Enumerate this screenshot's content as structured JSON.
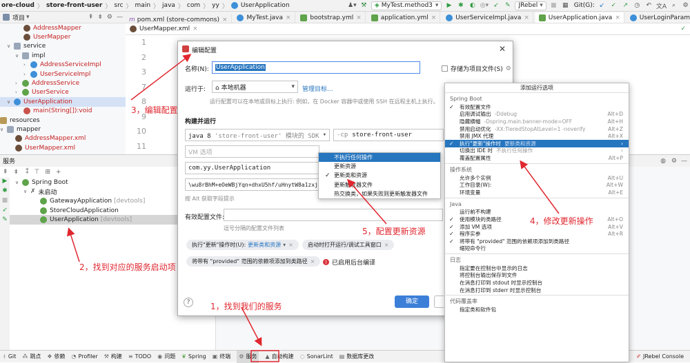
{
  "toolbar": {
    "crumbs": [
      "ore-cloud",
      "store-front-user",
      "src",
      "main",
      "java",
      "com",
      "yy",
      "UserApplication"
    ],
    "run_config": "MyTest.method3",
    "jrebel": "JRebel",
    "git": "Git(G):"
  },
  "project_panel": {
    "title": "项目",
    "items": [
      {
        "label": "AddressMapper",
        "red": true
      },
      {
        "label": "UserMapper",
        "red": true
      },
      {
        "label": "service"
      },
      {
        "label": "impl"
      },
      {
        "label": "AddressServiceImpl",
        "red": true
      },
      {
        "label": "UserServiceImpl",
        "red": true
      },
      {
        "label": "AddressService",
        "red": true
      },
      {
        "label": "UserService",
        "red": true
      },
      {
        "label": "UserApplication",
        "red": true
      },
      {
        "label": "main(String[]):void",
        "red": true
      },
      {
        "label": "resources"
      },
      {
        "label": "mapper"
      },
      {
        "label": "AddressMapper.xml",
        "red": true
      },
      {
        "label": "UserMapper.xml",
        "red": true
      }
    ]
  },
  "editor": {
    "tabs": [
      "pom.xml (store-commons)",
      "MyTest.java",
      "bootstrap.yml",
      "application.yml",
      "UserServiceImpl.java",
      "UserApplication.java",
      "UserLoginParam.java"
    ],
    "active_tab": "UserApplication.java",
    "second_tab": "UserMapper.xml",
    "line_numbers": [
      "1",
      "2",
      "3",
      "7",
      "8",
      "9",
      "10",
      "11"
    ]
  },
  "services": {
    "title": "服务",
    "tree": [
      {
        "label": "Spring Boot"
      },
      {
        "label": "未启动"
      },
      {
        "label": "GatewayApplication",
        "suffix": "[devtools]"
      },
      {
        "label": "StoreCloudApplication",
        "suffix": ""
      },
      {
        "label": "UserApplication",
        "suffix": "[devtools]"
      }
    ]
  },
  "bottom_bar": {
    "items": [
      "Git",
      "跳点",
      "依赖",
      "Profiler",
      "构建",
      "TODO",
      "问题",
      "Spring",
      "终端",
      "服务",
      "自动构建",
      "SonarLint",
      "数据库更改"
    ],
    "right": "JRebel Console"
  },
  "dialog": {
    "title": "编辑配置",
    "name_label": "名称(N):",
    "name_value": "UserApplication",
    "store_label": "存储为项目文件(S)",
    "run_on_label": "运行于:",
    "run_on_value": "本地机器",
    "manage_targets": "管理目标...",
    "run_on_hint": "运行配置可以在本地或目标上执行: 例如，在 Docker 容器中或使用 SSH 在远程主机上执行。",
    "build_run_label": "构建并运行",
    "jdk_value": "java 8",
    "jdk_hint": "'store-front-user' 模块的 SDK",
    "cp_flag": "-cp",
    "cp_value": "store-front-user",
    "vm_placeholder": "VM 选项",
    "main_class": "com.yy.UserApplication",
    "program_args": "\\wu8rBhM+eOeWBjYqn+dhxU5hf/uHnytW8a1zxjb",
    "alt_hint": "按 Alt 获取字段提示",
    "active_profiles_label": "有效配置文件:",
    "profiles_hint": "逗号分隔的配置文件列表",
    "chip1_label": "执行\"更新\"操作时(U):",
    "chip1_value": "更新类和资源",
    "chip2": "启动时打开运行/调试工具窗口",
    "chip3": "将带有 \"provided\" 范围的依赖项添加到类路径",
    "warn": "已启用后台编译",
    "ok": "确定"
  },
  "update_menu": {
    "items": [
      "不执行任何操作",
      "更新资源",
      "更新类和资源",
      "更新触发器文件",
      "热交换类，如果失败则更新触发器文件"
    ],
    "highlighted": 0,
    "checked": 2
  },
  "options_popup": {
    "title": "添加运行选项",
    "sections": [
      {
        "name": "Spring Boot",
        "items": [
          {
            "label": "有效配置文件",
            "checked": true
          },
          {
            "label": "启用调试输出",
            "hint": "-Ddebug",
            "shortcut": "Alt+D"
          },
          {
            "label": "隐藏横幅",
            "hint": "-Dspring.main.banner-mode=OFF",
            "shortcut": "Alt+H"
          },
          {
            "label": "禁用启动优化",
            "hint": "-XX:TieredStopAtLevel=1 -noverify",
            "shortcut": "Alt+Z"
          },
          {
            "label": "禁用 JMX 代理",
            "shortcut": "Alt+X"
          },
          {
            "label": "执行\"更新\"操作时",
            "hint": "更新类和资源",
            "checked": true,
            "highlight": true,
            "arrow": true
          },
          {
            "label": "切换出 IDE 时",
            "hint": "不执行任何操作",
            "arrow": true
          },
          {
            "label": "覆盖配置属性",
            "shortcut": "Alt+P"
          }
        ]
      },
      {
        "name": "操作系统",
        "items": [
          {
            "label": "允许多个实例",
            "shortcut": "Alt+U"
          },
          {
            "label": "工作目录(W):",
            "shortcut": "Alt+W"
          },
          {
            "label": "环境变量",
            "shortcut": "Alt+E"
          }
        ]
      },
      {
        "name": "Java",
        "items": [
          {
            "label": "运行前不构建"
          },
          {
            "label": "使用模块的类路径",
            "checked": true,
            "shortcut": "Alt+O"
          },
          {
            "label": "添加 VM 选项",
            "checked": true,
            "shortcut": "Alt+V"
          },
          {
            "label": "程序实参",
            "checked": true,
            "shortcut": "Alt+R"
          },
          {
            "label": "将带有 \"provided\" 范围的依赖项添加到类路径",
            "checked": true
          },
          {
            "label": "缩短命令行"
          }
        ]
      },
      {
        "name": "日志",
        "items": [
          {
            "label": "指定要在控制台中显示的日志"
          },
          {
            "label": "将控制台输出保存到文件"
          },
          {
            "label": "在消息打印到 stdout 时显示控制台"
          },
          {
            "label": "在消息打印到 stderr 时显示控制台"
          }
        ]
      },
      {
        "name": "代码覆盖率",
        "items": [
          {
            "label": "指定类和软件包"
          }
        ]
      }
    ]
  },
  "annotations": {
    "a1": "1，找到我们的服务",
    "a2": "2，找到对应的服务启动项",
    "a3": "3，编辑配置",
    "a4": "4，修改更新操作",
    "a5": "5，配置更新资源"
  },
  "colors": {
    "accent": "#2675bf",
    "annotation": "#e0272f",
    "highlight_text": "#2675bf"
  }
}
